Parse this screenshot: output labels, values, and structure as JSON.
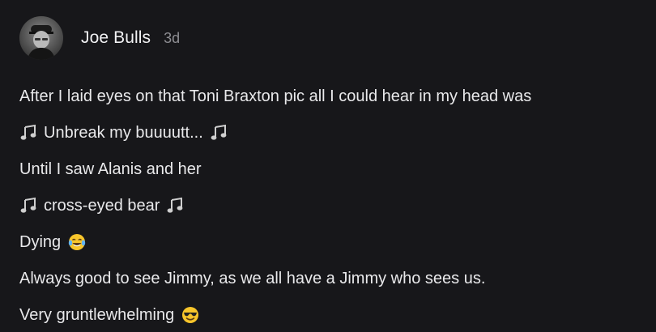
{
  "comment": {
    "author": "Joe Bulls",
    "time": "3d",
    "lines": [
      "After I laid eyes on that Toni Braxton pic all I could hear in my head was",
      "Unbreak my buuuutt...",
      "Until I saw Alanis and her",
      "cross-eyed bear",
      "Dying",
      "Always good to see Jimmy, as we all have a Jimmy who sees us.",
      "Very gruntlewhelming"
    ]
  },
  "icons": {
    "avatar": "avatar-photo",
    "music": "musical-notes-icon",
    "laugh": "face-with-tears-of-joy-icon",
    "cool": "smiling-face-with-sunglasses-icon"
  }
}
